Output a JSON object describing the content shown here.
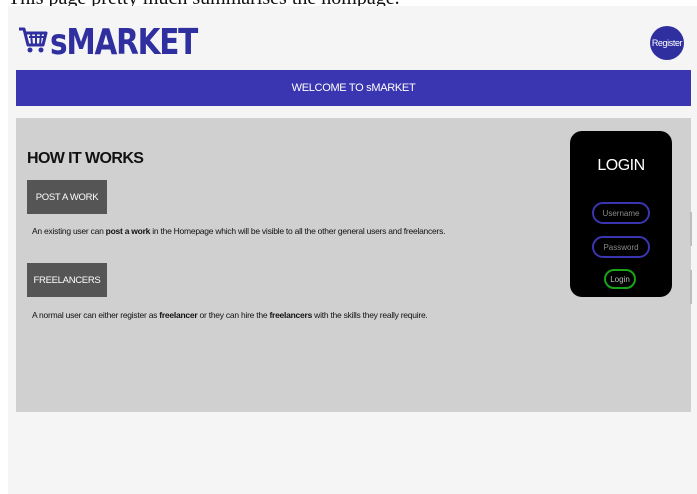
{
  "top_text": "This page pretty much summarises the hompage.",
  "header": {
    "logo_text": "sMARKET",
    "register_label": "Register"
  },
  "banner": {
    "text": "WELCOME TO sMARKET"
  },
  "how_it_works": {
    "title": "HOW IT WORKS",
    "post_button": "POST A WORK",
    "post_desc": {
      "before": "An existing user can ",
      "bold": "post a work",
      "after": " in the Homepage which will be visible to all the other general users and freelancers."
    },
    "freelancers_button": "FREELANCERS",
    "freelancers_desc": {
      "before": "A normal user can either register as ",
      "bold1": "freelancer",
      "middle": " or they can hire the ",
      "bold2": "freelancers",
      "after": " with the skills they really require."
    }
  },
  "login": {
    "title": "LOGIN",
    "username_placeholder": "Username",
    "password_placeholder": "Password",
    "button_label": "Login"
  },
  "colors": {
    "brand": "#2f2fa0",
    "banner": "#3a35b0",
    "panel": "#d0d0d0",
    "login_button_border": "#19a319"
  },
  "icons": {
    "logo": "shopping-cart-icon"
  }
}
